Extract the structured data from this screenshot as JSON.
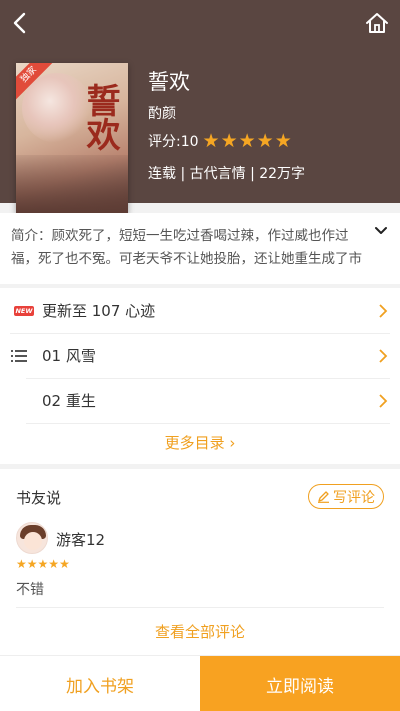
{
  "header": {
    "back_icon": "back-arrow-icon",
    "home_icon": "home-icon"
  },
  "book": {
    "title": "誓欢",
    "author": "酌颜",
    "score_label": "评分:10",
    "rating": 5,
    "rating_max": 5,
    "meta": "连载 | 古代言情 | 22万字",
    "cover_art_title": "誓欢",
    "cover_badge": "独家"
  },
  "intro": {
    "text": "简介：顾欢死了，短短一生吃过香喝过辣，作过威也作过福，死了也不冤。可老天爷不让她投胎，还让她重生成了市井姑娘……"
  },
  "chapters": {
    "latest_badge": "NEW",
    "latest": "更新至 107 心迹",
    "items": [
      "01 风雪",
      "02 重生"
    ],
    "more": "更多目录 ›"
  },
  "comments": {
    "title": "书友说",
    "write_label": "写评论",
    "items": [
      {
        "user": "游客12",
        "rating": 5,
        "text": "不错"
      }
    ],
    "view_all": "查看全部评论"
  },
  "bottom": {
    "add_shelf": "加入书架",
    "read_now": "立即阅读"
  },
  "colors": {
    "header_bg": "#5a4641",
    "accent": "#f8a221",
    "star": "#f5a623",
    "new_badge": "#e8413a"
  }
}
